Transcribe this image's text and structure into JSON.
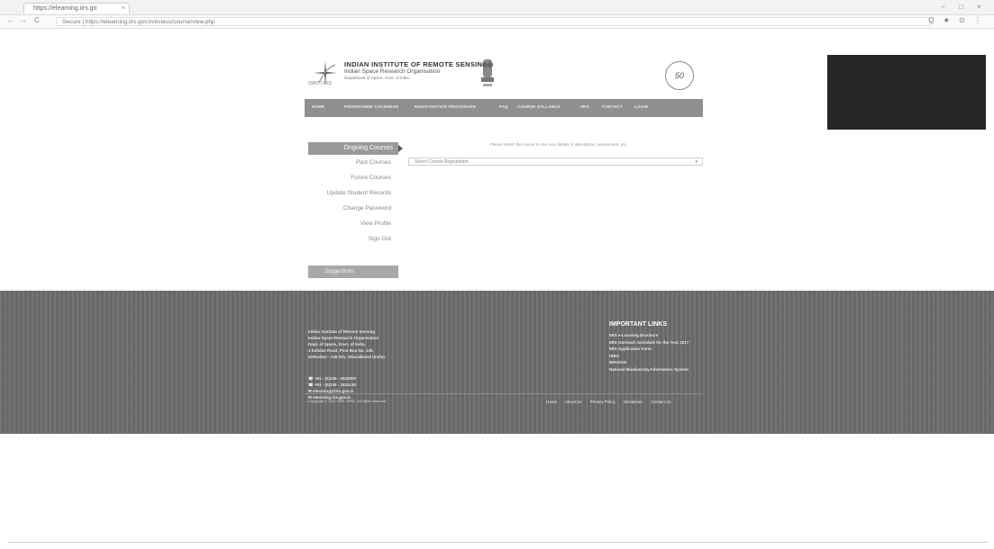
{
  "browser": {
    "tab_title": "https://elearning.iirs.go",
    "tab_close": "×",
    "url": "Secure | https://elearning.iirs.gov.in/eclass/course/view.php",
    "back": "←",
    "forward": "→",
    "reload": "C",
    "window_controls": [
      "–",
      "□",
      "×"
    ],
    "ext_icons": "Q ★ ⊙ ⋮"
  },
  "header": {
    "logo_sub": "ISRO | IIRS",
    "title": "INDIAN INSTITUTE OF REMOTE SENSING",
    "subtitle": "Indian Space Research Organisation",
    "dept": "Department of Space, Govt. of India",
    "anniversary": "50"
  },
  "nav": {
    "items": [
      "HOME",
      "PROGRAMME CALENDAR",
      "REGISTRATION PROCEDURE",
      "FAQ",
      "COURSE SYLLABUS",
      "IIRS",
      "CONTACT",
      "LOGIN"
    ]
  },
  "sidebar": {
    "active": "Ongoing Courses",
    "items": [
      "Past Courses",
      "Future Courses",
      "Update Student Records",
      "Change Password",
      "View Profile",
      "Sign Out"
    ],
    "button": "Suggestions"
  },
  "main": {
    "notice": "Please Select the course to see your details of attendance, assessment, etc.",
    "select_value": "Select Course Registration"
  },
  "footer": {
    "address": [
      "Indian Institute of Remote Sensing",
      "Indian Space Research Organisation",
      "Dept. of Space, Govt. of India,",
      "4 Kalidas Road, Post Box No. 135,",
      "Dehradun - 248 001, Uttarakhand (India)"
    ],
    "contact": [
      "+91 - (0)135 - 2524000",
      "+91 - (0)135 - 2524130",
      "elearning@iirs.gov.in",
      "elearning.iirs.gov.in"
    ],
    "links_title": "IMPORTANT LINKS",
    "links": [
      "IIRS e-Learning Brochure",
      "IIRS Outreach Schedule for the Year 2017",
      "IIRS Application Form",
      "ISRO",
      "BHUVAN",
      "National Biodiversity Information System"
    ],
    "copyright": "Copyright © 2017 IIRS, ISRO. All rights reserved.",
    "nav": [
      "Home",
      "About Us",
      "Privacy Policy",
      "Disclaimer",
      "Contact Us"
    ]
  }
}
